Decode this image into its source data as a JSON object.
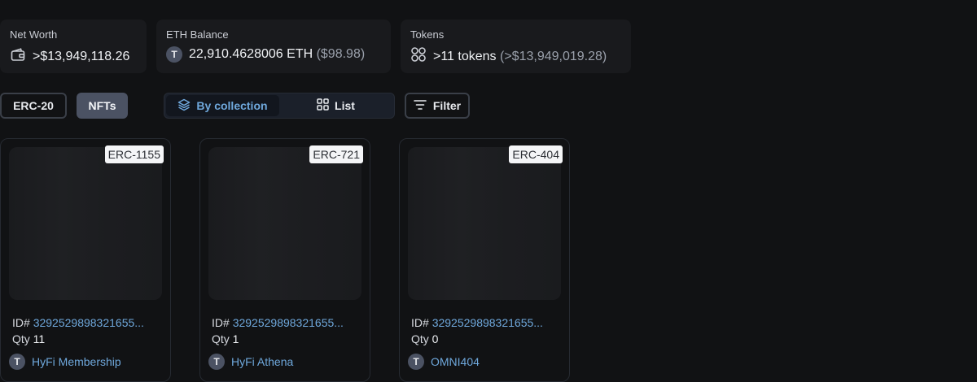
{
  "stats": {
    "net_worth": {
      "label": "Net Worth",
      "value": ">$13,949,118.26",
      "icon": "wallet-icon"
    },
    "eth_balance": {
      "label": "ETH Balance",
      "badge": "T",
      "value": "22,910.4628006 ETH",
      "usd": "($98.98)"
    },
    "tokens": {
      "label": "Tokens",
      "icon": "tokens-grid-icon",
      "value": ">11 tokens",
      "usd": "(>$13,949,019.28)"
    }
  },
  "controls": {
    "erc20_label": "ERC-20",
    "nfts_label": "NFTs",
    "by_collection_label": "By collection",
    "list_label": "List",
    "filter_label": "Filter"
  },
  "nfts": [
    {
      "standard": "ERC-1155",
      "id_prefix": "ID#",
      "id": "3292529898321655...",
      "qty_label": "Qty",
      "qty": "11",
      "badge": "T",
      "collection": "HyFi Membership"
    },
    {
      "standard": "ERC-721",
      "id_prefix": "ID#",
      "id": "3292529898321655...",
      "qty_label": "Qty",
      "qty": "1",
      "badge": "T",
      "collection": "HyFi Athena"
    },
    {
      "standard": "ERC-404",
      "id_prefix": "ID#",
      "id": "3292529898321655...",
      "qty_label": "Qty",
      "qty": "0",
      "badge": "T",
      "collection": "OMNI404"
    }
  ],
  "colors": {
    "accent": "#6fa8dc",
    "background": "#111214",
    "card": "#191a1d"
  }
}
